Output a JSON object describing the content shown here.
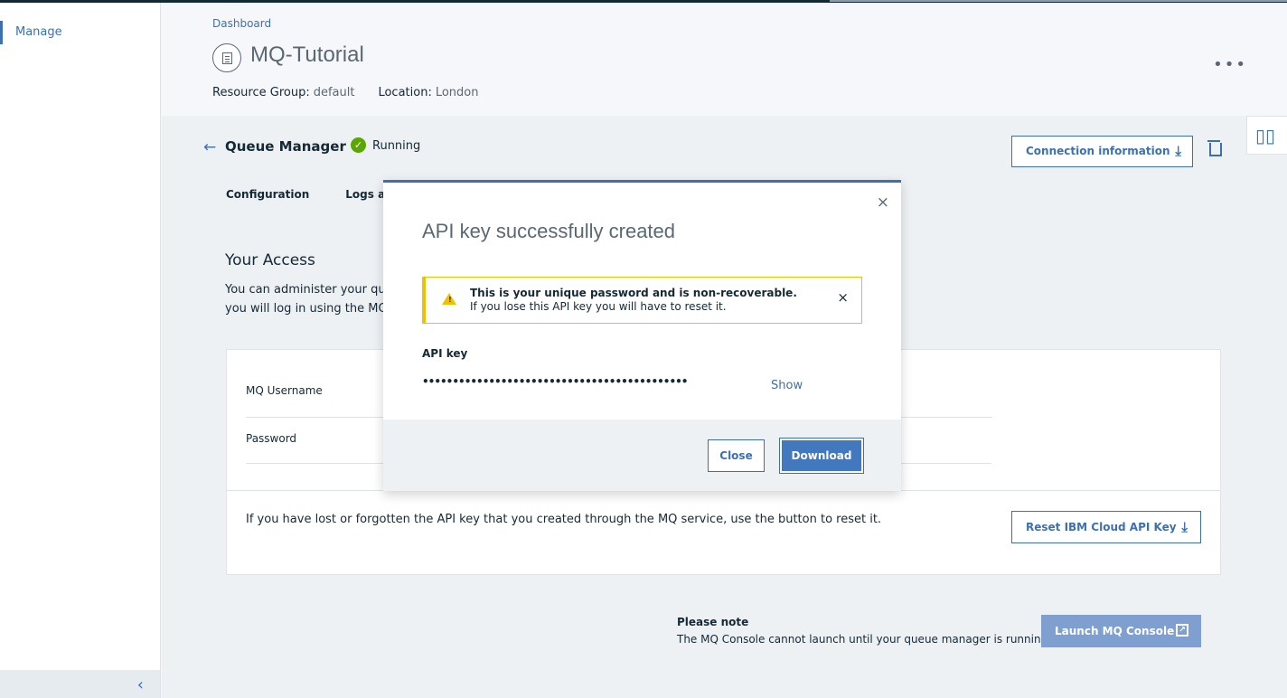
{
  "sidebar": {
    "manage_label": "Manage",
    "collapse_icon": "‹"
  },
  "header": {
    "breadcrumb": "Dashboard",
    "title": "MQ-Tutorial",
    "resource_group_label": "Resource Group:",
    "resource_group_value": "default",
    "location_label": "Location:",
    "location_value": "London",
    "more_icon": "•••"
  },
  "queue_manager": {
    "back_icon": "←",
    "title": "Queue Manager",
    "status_icon": "✓",
    "status": "Running",
    "connection_button": "Connection information",
    "download_icon": "⤓",
    "map_icon": "▯▯"
  },
  "tabs": [
    "Configuration",
    "Logs and"
  ],
  "access": {
    "title": "Your Access",
    "desc_line1": "You can administer your qu",
    "desc_line2": "you will log in using the MQ",
    "username_label": "MQ Username",
    "password_label": "Password",
    "reset_text": "If you have lost or forgotten the API key that you created through the MQ service, use the button to reset it.",
    "reset_button": "Reset IBM Cloud API Key"
  },
  "note": {
    "heading": "Please note",
    "body": "The MQ Console cannot launch until your queue manager is running.",
    "launch_button": "Launch MQ Console",
    "launch_icon": "↗"
  },
  "modal": {
    "close_icon": "×",
    "title": "API key successfully created",
    "warning_title": "This is your unique password and is non-recoverable.",
    "warning_body": "If you lose this API key you will have to reset it.",
    "warning_icon": "!",
    "warning_close": "×",
    "api_key_label": "API key",
    "api_key_masked": "••••••••••••••••••••••••••••••••••••••••••••",
    "show_link": "Show",
    "close_button": "Close",
    "download_button": "Download"
  }
}
